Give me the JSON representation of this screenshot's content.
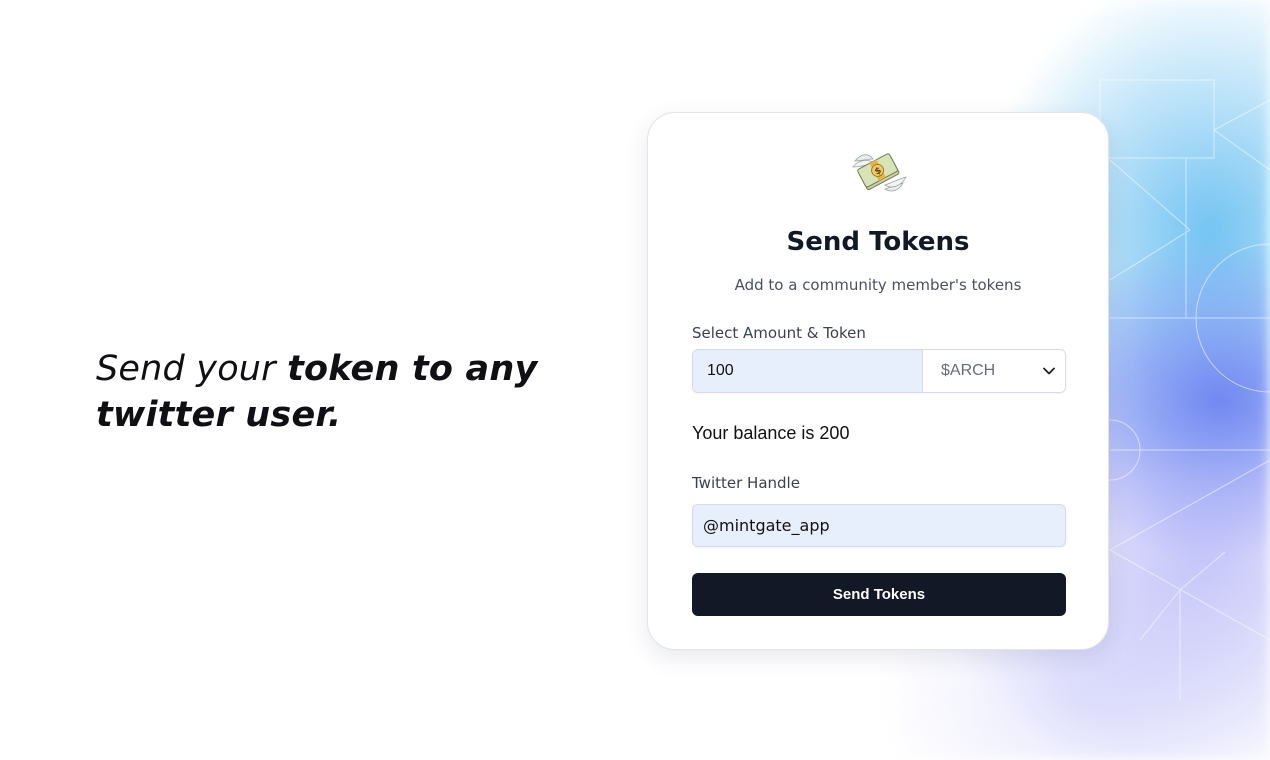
{
  "headline": {
    "light_part": "Send your ",
    "bold_part": "token to any twitter user."
  },
  "card": {
    "logo_icon": "money-with-wings-icon",
    "title": "Send Tokens",
    "subtitle": "Add to a community member's tokens",
    "amount_label": "Select Amount & Token",
    "amount_value": "100",
    "token_selected": "$ARCH",
    "balance_text": "Your balance is 200",
    "handle_label": "Twitter Handle",
    "handle_value": "@mintgate_app",
    "submit_label": "Send Tokens"
  },
  "colors": {
    "button_bg": "#121826",
    "input_bg": "#e8effc",
    "title": "#121826"
  }
}
